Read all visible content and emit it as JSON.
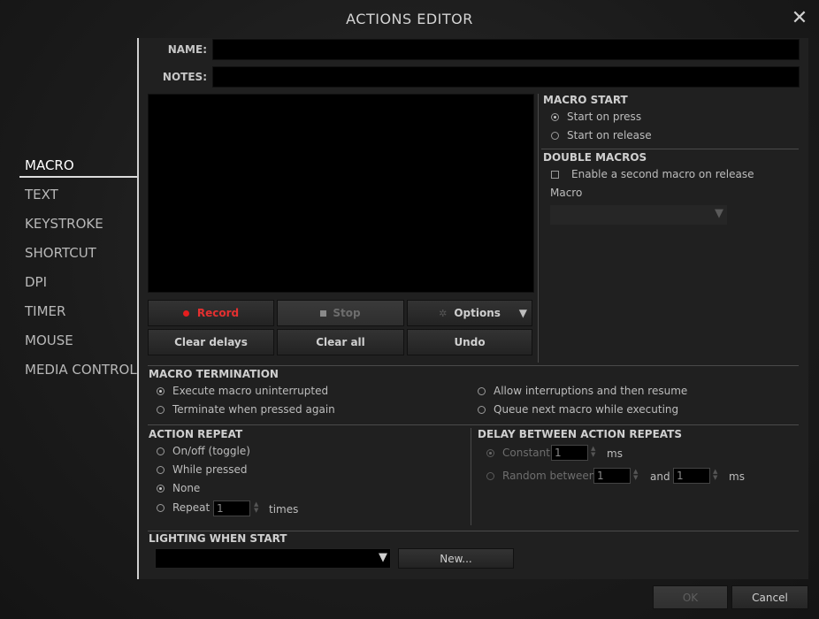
{
  "window": {
    "title": "ACTIONS EDITOR",
    "close_glyph": "✕"
  },
  "sidebar": {
    "items": [
      {
        "label": "MACRO",
        "active": true
      },
      {
        "label": "TEXT"
      },
      {
        "label": "KEYSTROKE"
      },
      {
        "label": "SHORTCUT"
      },
      {
        "label": "DPI"
      },
      {
        "label": "TIMER"
      },
      {
        "label": "MOUSE"
      },
      {
        "label": "MEDIA CONTROL"
      }
    ]
  },
  "form": {
    "name_label": "NAME:",
    "name_value": "",
    "notes_label": "NOTES:",
    "notes_value": ""
  },
  "recorder": {
    "record_label": "Record",
    "stop_label": "Stop",
    "options_label": "Options",
    "clear_delays_label": "Clear delays",
    "clear_all_label": "Clear all",
    "undo_label": "Undo",
    "record_color": "#e41e1e"
  },
  "macro_start": {
    "heading": "MACRO START",
    "options": [
      "Start on press",
      "Start on release"
    ],
    "selected": 0
  },
  "double_macros": {
    "heading": "DOUBLE MACROS",
    "enable_label": "Enable a second macro on release",
    "enabled": false,
    "macro_label": "Macro",
    "macro_value": ""
  },
  "macro_termination": {
    "heading": "MACRO TERMINATION",
    "options": [
      "Execute macro uninterrupted",
      "Terminate when pressed again",
      "Allow interruptions and then resume",
      "Queue next macro while executing"
    ],
    "selected": 0
  },
  "action_repeat": {
    "heading": "ACTION REPEAT",
    "options": [
      "On/off (toggle)",
      "While pressed",
      "None",
      "Repeat"
    ],
    "selected": 2,
    "repeat_value": "1",
    "times_label": "times"
  },
  "delay_between": {
    "heading": "DELAY BETWEEN ACTION REPEATS",
    "constant_label": "Constant",
    "constant_value": "1",
    "ms_label": "ms",
    "random_label": "Random between",
    "random_min": "1",
    "and_label": "and",
    "random_max": "1",
    "selected": 0
  },
  "lighting": {
    "heading": "LIGHTING WHEN START",
    "value": "",
    "new_label": "New..."
  },
  "footer": {
    "ok_label": "OK",
    "cancel_label": "Cancel"
  }
}
